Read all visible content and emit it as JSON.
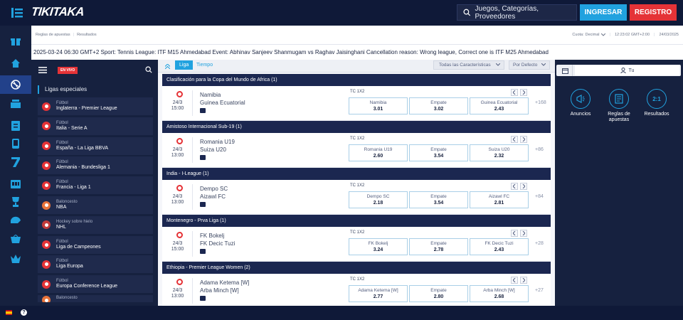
{
  "brand": {
    "logo": "TIKITAKA"
  },
  "header": {
    "search_placeholder": "Juegos, Categorías, Proveedores",
    "login_label": "INGRESAR",
    "register_label": "REGISTRO"
  },
  "subheader": {
    "breadcrumbs": [
      "Reglas de apuestas",
      "Resultados"
    ],
    "odds_label": "Cuota:",
    "odds_value": "Decimal",
    "time": "12:23:02 GMT+2:00",
    "date": "24/03/2025"
  },
  "ticker": {
    "text": "2025-03-24 06:30 GMT+2 Sport: Tennis League: ITF M15 Ahmedabad Event: Abhinav Sanjeev Shanmugam vs Raghav Jaisinghani Cancellation reason: Wrong league, Correct one is ITF M25 Ahmedabad"
  },
  "left_panel": {
    "live_badge": "EN VIVO",
    "section_title": "Ligas especiales",
    "leagues": [
      {
        "sport": "Fútbol",
        "name": "Inglaterra - Premier League",
        "icon": "football-icon"
      },
      {
        "sport": "Fútbol",
        "name": "Italia - Serie A",
        "icon": "football-icon"
      },
      {
        "sport": "Fútbol",
        "name": "España - La Liga BBVA",
        "icon": "football-icon"
      },
      {
        "sport": "Fútbol",
        "name": "Alemania - Bundesliga 1",
        "icon": "football-icon"
      },
      {
        "sport": "Fútbol",
        "name": "Francia - Liga 1",
        "icon": "football-icon"
      },
      {
        "sport": "Baloncesto",
        "name": "NBA",
        "icon": "basketball-icon"
      },
      {
        "sport": "Hockey sobre hielo",
        "name": "NHL",
        "icon": "hockey-icon"
      },
      {
        "sport": "Fútbol",
        "name": "Liga de Campeones",
        "icon": "football-icon"
      },
      {
        "sport": "Fútbol",
        "name": "Liga Europa",
        "icon": "football-icon"
      },
      {
        "sport": "Fútbol",
        "name": "Europa Conference League",
        "icon": "football-icon"
      },
      {
        "sport": "Baloncesto",
        "name": "",
        "icon": "basketball-icon"
      }
    ]
  },
  "center": {
    "tabs": [
      {
        "label": "Liga"
      },
      {
        "label": "Tiempo"
      }
    ],
    "filter_all": "Todas las Características",
    "filter_sort": "Por Defecto",
    "events": [
      {
        "league": "Clasificación para la Copa del Mundo de Africa (1)",
        "date": "24/3",
        "time": "15:00",
        "home": "Namibia",
        "away": "Guinea Ecuatorial",
        "market": "TC 1X2",
        "odds": [
          {
            "label": "Namibia",
            "value": "3.01"
          },
          {
            "label": "Empate",
            "value": "3.02"
          },
          {
            "label": "Guinea Ecuatorial",
            "value": "2.43"
          }
        ],
        "more": "+168"
      },
      {
        "league": "Amistoso Internacional Sub-19 (1)",
        "date": "24/3",
        "time": "13:00",
        "home": "Romania U19",
        "away": "Suiza U20",
        "market": "TC 1X2",
        "odds": [
          {
            "label": "Romania U19",
            "value": "2.60"
          },
          {
            "label": "Empate",
            "value": "3.54"
          },
          {
            "label": "Suiza U20",
            "value": "2.32"
          }
        ],
        "more": "+86"
      },
      {
        "league": "India - I-League (1)",
        "date": "24/3",
        "time": "13:00",
        "home": "Dempo SC",
        "away": "Aizawl FC",
        "market": "TC 1X2",
        "odds": [
          {
            "label": "Dempo SC",
            "value": "2.18"
          },
          {
            "label": "Empate",
            "value": "3.54"
          },
          {
            "label": "Aizawl FC",
            "value": "2.81"
          }
        ],
        "more": "+84"
      },
      {
        "league": "Montenegro - Prva Liga (1)",
        "date": "24/3",
        "time": "15:00",
        "home": "FK Bokelj",
        "away": "FK Decic Tuzi",
        "market": "TC 1X2",
        "odds": [
          {
            "label": "FK Bokelj",
            "value": "3.24"
          },
          {
            "label": "Empate",
            "value": "2.78"
          },
          {
            "label": "FK Decic Tuzi",
            "value": "2.43"
          }
        ],
        "more": "+28"
      },
      {
        "league": "Ethiopia - Premier League Women (2)",
        "date": "24/3",
        "time": "13:00",
        "home": "Adama Ketema [W]",
        "away": "Arba Minch [W]",
        "market": "TC 1X2",
        "odds": [
          {
            "label": "Adama Ketema [W]",
            "value": "2.77"
          },
          {
            "label": "Empate",
            "value": "2.80"
          },
          {
            "label": "Arba Minch [W]",
            "value": "2.68"
          }
        ],
        "more": "+27"
      }
    ]
  },
  "right_panel": {
    "user_label": "Tu",
    "buttons": [
      {
        "label": "Anuncios",
        "icon": "megaphone-icon"
      },
      {
        "label": "Reglas de apuestas",
        "icon": "rules-icon"
      },
      {
        "label": "Resultados",
        "icon": "score-icon",
        "glyph": "2:1"
      }
    ]
  },
  "colors": {
    "primary": "#21a2df",
    "danger": "#e53337",
    "dark": "#16213f",
    "header": "#1b2750"
  }
}
